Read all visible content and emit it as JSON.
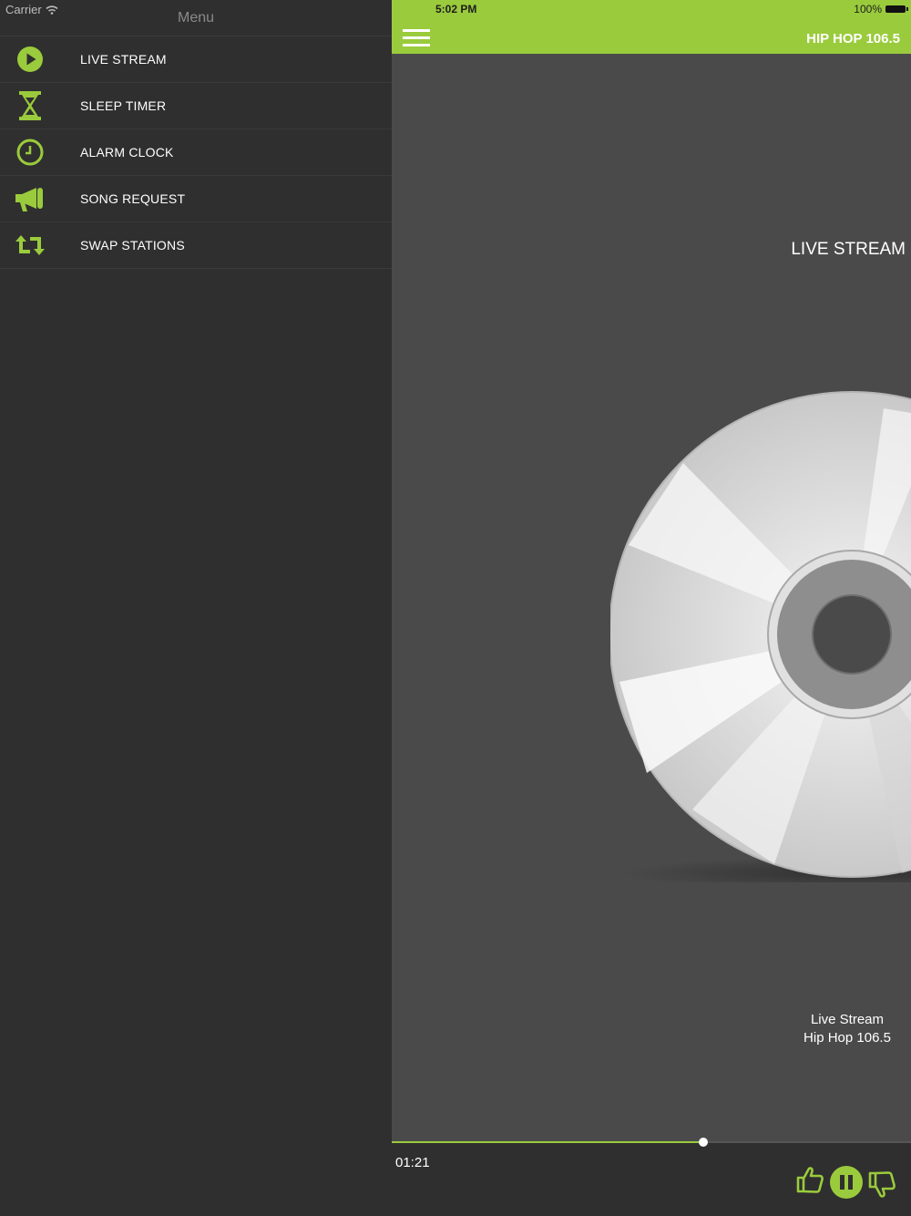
{
  "status_bar": {
    "carrier": "Carrier",
    "time": "5:02 PM",
    "battery": "100%"
  },
  "sidebar": {
    "title": "Menu",
    "items": [
      {
        "label": "LIVE STREAM",
        "icon": "play-circle-icon"
      },
      {
        "label": "SLEEP TIMER",
        "icon": "hourglass-icon"
      },
      {
        "label": "ALARM CLOCK",
        "icon": "clock-icon"
      },
      {
        "label": "SONG REQUEST",
        "icon": "megaphone-icon"
      },
      {
        "label": "SWAP STATIONS",
        "icon": "swap-arrows-icon"
      }
    ]
  },
  "header": {
    "station": "HIP HOP 106.5",
    "menu_icon": "hamburger-menu-icon"
  },
  "main": {
    "section_title": "LIVE STREAM",
    "now_playing": {
      "line1": "Live Stream",
      "line2": "Hip Hop 106.5"
    }
  },
  "player": {
    "elapsed": "01:21",
    "progress_fraction": 0.6,
    "controls": [
      "thumbs-up-icon",
      "pause-icon",
      "thumbs-down-icon"
    ]
  },
  "colors": {
    "accent": "#9acb3c",
    "sidebar_bg": "#2f2f2f",
    "main_bg": "#4a4a4a",
    "text": "#ffffff"
  }
}
